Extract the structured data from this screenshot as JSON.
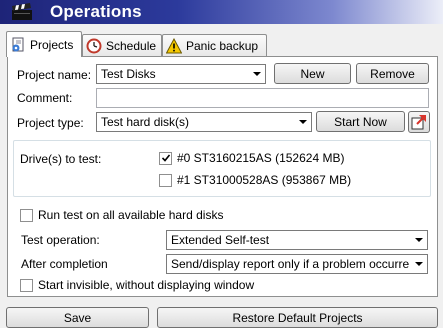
{
  "window": {
    "title": "Operations"
  },
  "tabs": [
    {
      "label": "Projects",
      "icon": "gear-document-icon",
      "active": true
    },
    {
      "label": "Schedule",
      "icon": "clock-icon",
      "active": false
    },
    {
      "label": "Panic backup",
      "icon": "warning-icon",
      "active": false
    }
  ],
  "form": {
    "project_name_label": "Project name:",
    "project_name_value": "Test Disks",
    "new_button": "New",
    "remove_button": "Remove",
    "comment_label": "Comment:",
    "comment_value": "",
    "project_type_label": "Project type:",
    "project_type_value": "Test hard disk(s)",
    "start_now_button": "Start Now",
    "start_now_icon": "export-arrow-icon"
  },
  "drives": {
    "label": "Drive(s) to test:",
    "items": [
      {
        "label": "#0 ST3160215AS (152624 MB)",
        "checked": true
      },
      {
        "label": "#1 ST31000528AS (953867 MB)",
        "checked": false
      }
    ]
  },
  "options": {
    "run_all_label": "Run test on all available hard disks",
    "run_all_checked": false,
    "test_operation_label": "Test operation:",
    "test_operation_value": "Extended Self-test",
    "after_completion_label": "After completion",
    "after_completion_value": "Send/display report only if a problem occurre",
    "start_invisible_label": "Start invisible, without displaying window",
    "start_invisible_checked": false
  },
  "footer": {
    "save_button": "Save",
    "restore_button": "Restore Default Projects"
  },
  "colors": {
    "title_bar_start": "#1e2478",
    "title_bar_end": "#eceef8",
    "warning_yellow": "#f5c800",
    "clock_red": "#c0392b"
  }
}
